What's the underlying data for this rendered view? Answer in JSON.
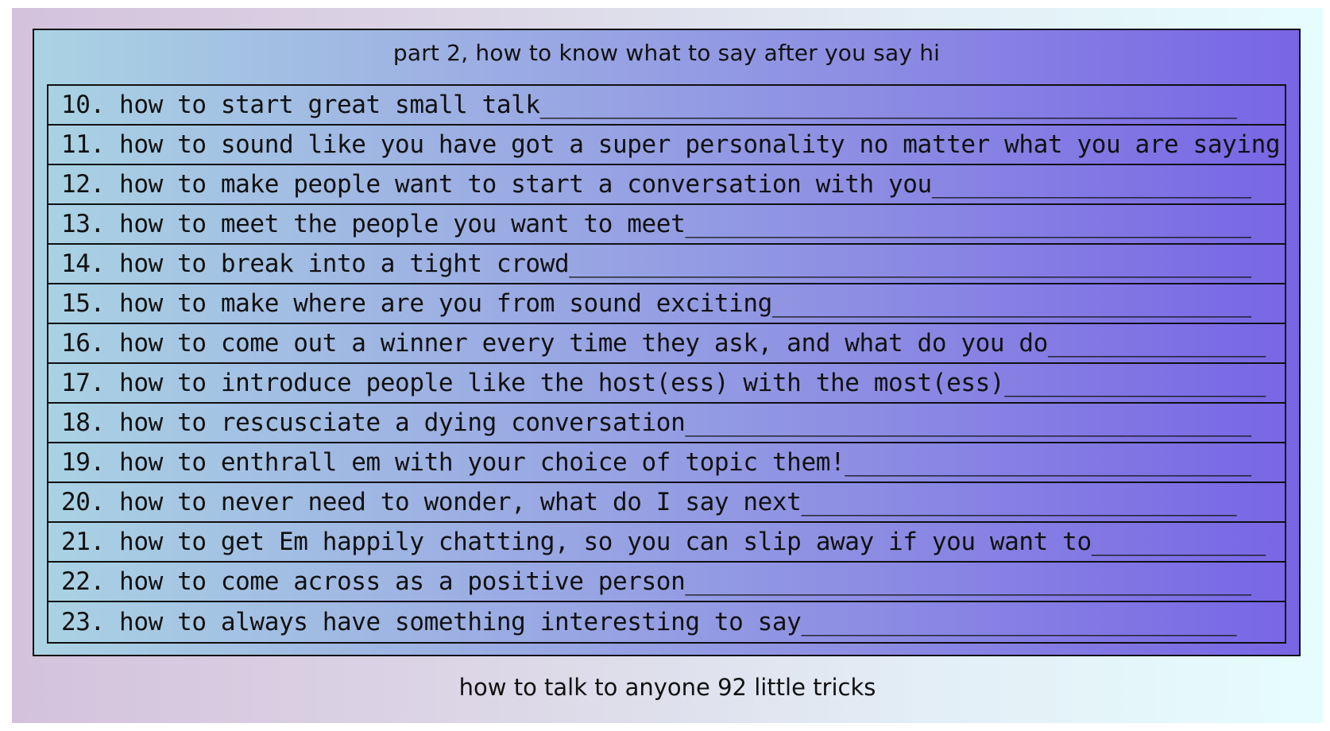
{
  "panel": {
    "title": "part 2, how to know what to say after you say hi"
  },
  "items": [
    {
      "text": "10. how to start great small talk________________________________________________"
    },
    {
      "text": "11. how to sound like you have got a super personality no matter what you are saying"
    },
    {
      "text": "12. how to make people want to start a conversation with you______________________"
    },
    {
      "text": "13. how to meet the people you want to meet_______________________________________"
    },
    {
      "text": "14. how to break into a tight crowd_______________________________________________"
    },
    {
      "text": "15. how to make where are you from sound exciting_________________________________"
    },
    {
      "text": "16. how to come out a winner every time they ask, and what do you do_______________"
    },
    {
      "text": "17. how to introduce people like the host(ess) with the most(ess)__________________"
    },
    {
      "text": "18. how to rescusciate a dying conversation_______________________________________"
    },
    {
      "text": "19. how to enthrall em with your choice of topic them!____________________________"
    },
    {
      "text": "20. how to never need to wonder, what do I say next______________________________"
    },
    {
      "text": "21. how to get Em happily chatting, so you can slip away if you want to____________"
    },
    {
      "text": "22. how to come across as a positive person_______________________________________"
    },
    {
      "text": "23. how to always have something interesting to say______________________________"
    }
  ],
  "caption": "how to talk to anyone 92 little tricks"
}
